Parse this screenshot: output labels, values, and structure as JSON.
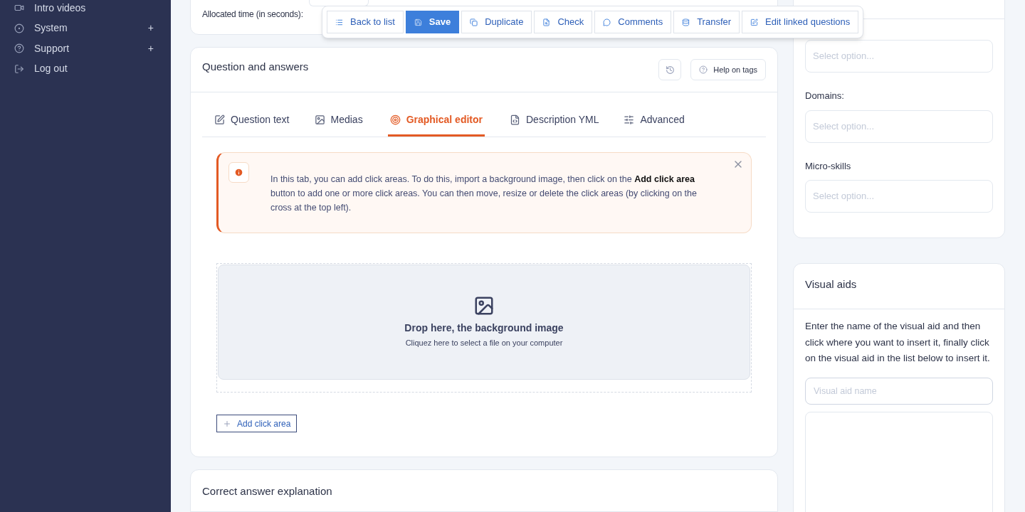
{
  "sidebar": {
    "items": [
      {
        "label": "Intro videos"
      },
      {
        "label": "System",
        "expand_mark": "+"
      },
      {
        "label": "Support",
        "expand_mark": "+"
      },
      {
        "label": "Log out"
      }
    ]
  },
  "settings_card": {
    "allocated_time_label": "Allocated time (in seconds):"
  },
  "toolbar": [
    {
      "label": "Back to list",
      "selected": false
    },
    {
      "label": "Save",
      "selected": true
    },
    {
      "label": "Duplicate",
      "selected": false
    },
    {
      "label": "Check",
      "selected": false
    },
    {
      "label": "Comments",
      "selected": false
    },
    {
      "label": "Transfer",
      "selected": false
    },
    {
      "label": "Edit linked questions",
      "selected": false
    }
  ],
  "question_card": {
    "title": "Question and answers",
    "help_button": "Help on tags",
    "tabs": [
      {
        "label": "Question text",
        "selected": false
      },
      {
        "label": "Medias",
        "selected": false
      },
      {
        "label": "Graphical editor",
        "selected": true
      },
      {
        "label": "Description YML",
        "selected": false
      },
      {
        "label": "Advanced",
        "selected": false
      }
    ],
    "alert": "In this tab, you can add click areas. To do this, import a background image, then click on the **Add click area** button to add one or more click areas. You can then move, resize or delete the click areas (by clicking on the cross at the top left).",
    "dropzone": {
      "title": "Drop here, the background image",
      "subtitle": "Cliquez here to select a file on your computer"
    },
    "add_button": "Add click area"
  },
  "explanation_card": {
    "title": "Correct answer explanation"
  },
  "tags_card": {
    "fields": [
      {
        "placeholder": "Select option..."
      },
      {
        "label": "Domains:",
        "placeholder": "Select option..."
      },
      {
        "label": "Micro-skills",
        "placeholder": "Select option..."
      }
    ]
  },
  "visual_aids": {
    "title": "Visual aids",
    "description": "Enter the name of the visual aid and then click where you want to insert it, finally click on the visual aid in the list below to insert it.",
    "name_placeholder": "Visual aid name"
  }
}
